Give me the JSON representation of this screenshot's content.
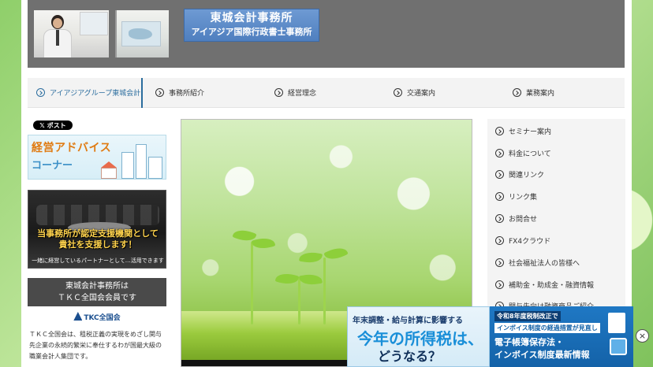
{
  "header": {
    "logo_line1": "東城会計事務所",
    "logo_line2": "アイアジア国際行政書士事務所"
  },
  "nav": {
    "items": [
      {
        "label": "アイアジアグループ東城会計",
        "active": true
      },
      {
        "label": "事務所紹介"
      },
      {
        "label": "経営理念"
      },
      {
        "label": "交通案内"
      },
      {
        "label": "業務案内"
      }
    ]
  },
  "left": {
    "post_button": "ポスト",
    "advice_line1": "経営アドバイス",
    "advice_line2": "コーナー",
    "support_msg": "当事務所が認定支援機関として貴社を支援します！",
    "support_sub": "一緒に経営しているパートナーとして…活用できます",
    "tkc_box_line1": "東城会計事務所は",
    "tkc_box_line2": "ＴＫＣ全国会会員です",
    "tkc_logo": "TKC全国会",
    "tkc_text": "ＴＫＣ全国会は、租税正義の実現をめざし関与先企業の永続的繁栄に奉仕するわが国最大級の職業会計人集団です。"
  },
  "side_menu": {
    "items": [
      "セミナー案内",
      "料金について",
      "関連リンク",
      "リンク集",
      "お問合せ",
      "FX4クラウド",
      "社会福祉法人の皆様へ",
      "補助金・助成金・融資情報",
      "開与先向け融資商品ご紹介"
    ]
  },
  "ad": {
    "left_top": "年末調整・給与計算に影響する",
    "left_big1": "今年の所得税は、",
    "left_big2": "どうなる？",
    "right_line1": "令和8年度税制改正で",
    "right_line2": "インボイス制度の経過措置が見直し",
    "right_line3": "電子帳簿保存法・",
    "right_line4": "インボイス制度最新情報",
    "close": "×"
  },
  "colors": {
    "header_bg": "#707070",
    "logo_bg": "#5b88c6",
    "active_nav": "#2b6d9e",
    "ad_blue": "#1a8fd8"
  }
}
